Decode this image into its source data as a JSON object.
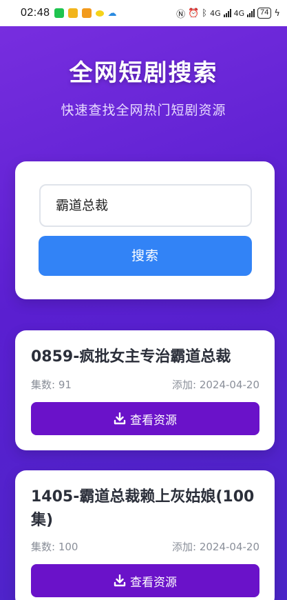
{
  "status_bar": {
    "time": "02:48",
    "network_1": "4G",
    "network_2": "4G",
    "battery": "74"
  },
  "header": {
    "title": "全网短剧搜索",
    "subtitle": "快速查找全网热门短剧资源"
  },
  "search": {
    "query": "霸道总裁",
    "button_label": "搜索"
  },
  "results": [
    {
      "title": "0859-疯批女主专治霸道总裁",
      "episodes": "集数: 91",
      "added": "添加: 2024-04-20",
      "button_label": "查看资源"
    },
    {
      "title": "1405-霸道总裁赖上灰姑娘(100集)",
      "episodes": "集数: 100",
      "added": "添加: 2024-04-20",
      "button_label": "查看资源"
    }
  ],
  "colors": {
    "background_start": "#7a2fe0",
    "background_end": "#4b25c8",
    "search_button": "#3283f6",
    "result_button": "#6a12c9"
  }
}
